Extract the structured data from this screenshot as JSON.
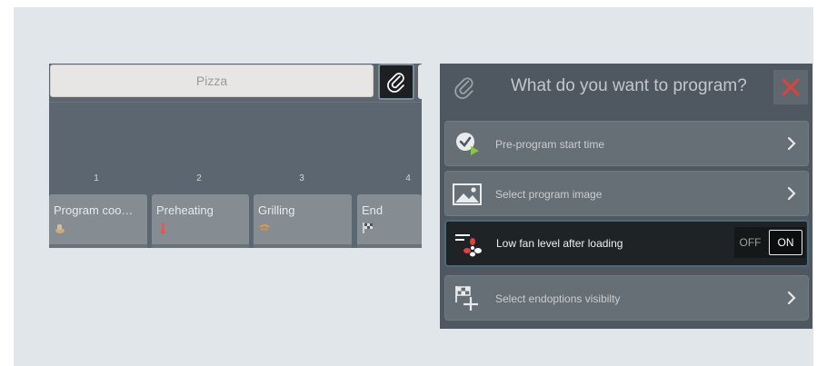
{
  "left_panel": {
    "program_name": "Pizza",
    "steps": [
      {
        "number": "1",
        "label": "Program coo…",
        "icon": "cooking-icon",
        "icon_color": "#d6b98a"
      },
      {
        "number": "2",
        "label": "Preheating",
        "icon": "thermometer-icon",
        "icon_color": "#e0574f"
      },
      {
        "number": "3",
        "label": "Grilling",
        "icon": "grill-icon",
        "icon_color": "#e4913c"
      },
      {
        "number": "4",
        "label": "End",
        "icon": "checkered-flag-icon",
        "icon_color": "#e8e8e8"
      }
    ]
  },
  "right_panel": {
    "question": "What do you want to program?",
    "options": [
      {
        "label": "Pre-program start time",
        "icon": "clock-play-icon"
      },
      {
        "label": "Select program image",
        "icon": "image-icon"
      },
      {
        "label": "Low fan level after loading",
        "icon": "fan-low-icon"
      },
      {
        "label": "Select endoptions visibilty",
        "icon": "flag-plus-icon"
      }
    ],
    "fan_toggle": {
      "off_label": "OFF",
      "on_label": "ON",
      "selected": "ON"
    }
  },
  "colors": {
    "close_accent": "#e0413a",
    "checklist_accent": "#4a9fd6",
    "play_accent": "#8cc63f"
  }
}
